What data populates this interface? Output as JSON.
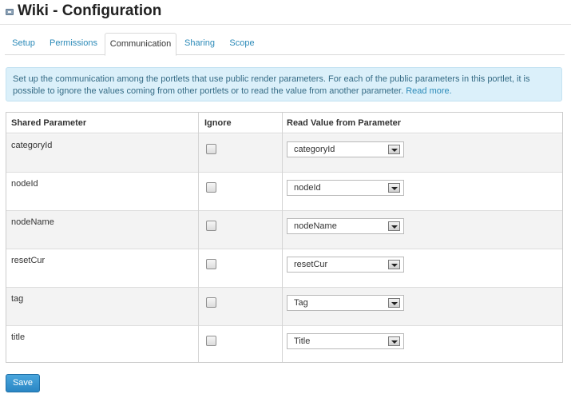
{
  "header": {
    "title": "Wiki - Configuration",
    "icon": "portlet-config-icon"
  },
  "tabs": [
    {
      "label": "Setup",
      "active": false
    },
    {
      "label": "Permissions",
      "active": false
    },
    {
      "label": "Communication",
      "active": true
    },
    {
      "label": "Sharing",
      "active": false
    },
    {
      "label": "Scope",
      "active": false
    }
  ],
  "info": {
    "text": "Set up the communication among the portlets that use public render parameters. For each of the public parameters in this portlet, it is possible to ignore the values coming from other portlets or to read the value from another parameter.",
    "link": "Read more."
  },
  "table": {
    "headers": [
      "Shared Parameter",
      "Ignore",
      "Read Value from Parameter"
    ],
    "rows": [
      {
        "parameter": "categoryId",
        "ignore": false,
        "read_value": "categoryId"
      },
      {
        "parameter": "nodeId",
        "ignore": false,
        "read_value": "nodeId"
      },
      {
        "parameter": "nodeName",
        "ignore": false,
        "read_value": "nodeName"
      },
      {
        "parameter": "resetCur",
        "ignore": false,
        "read_value": "resetCur"
      },
      {
        "parameter": "tag",
        "ignore": false,
        "read_value": "Tag"
      },
      {
        "parameter": "title",
        "ignore": false,
        "read_value": "Title"
      }
    ]
  },
  "actions": {
    "save_label": "Save"
  },
  "colors": {
    "accent": "#2b8ab8",
    "info_bg": "#dbf0fa",
    "button": "#2a86c4"
  }
}
